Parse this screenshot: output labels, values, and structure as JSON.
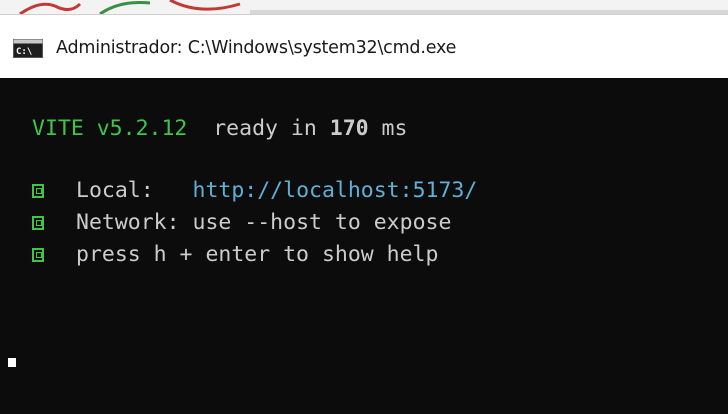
{
  "window": {
    "title": "Administrador:  C:\\Windows\\system32\\cmd.exe",
    "icon": "cmd-console-icon"
  },
  "console": {
    "vite_name": "VITE",
    "vite_version": "v5.2.12",
    "ready_text": "ready in",
    "ready_ms": "170",
    "ready_unit": "ms",
    "lines": [
      {
        "label": "Local:",
        "value": "http://localhost:5173/"
      },
      {
        "label": "Network:",
        "value": "use --host to expose"
      },
      {
        "label": "press h + enter to show help",
        "value": ""
      }
    ]
  },
  "colors": {
    "terminal_bg": "#0c0c0c",
    "terminal_text": "#cccccc",
    "vite_green": "#3fc54a",
    "url_cyan": "#5fb0d6"
  }
}
